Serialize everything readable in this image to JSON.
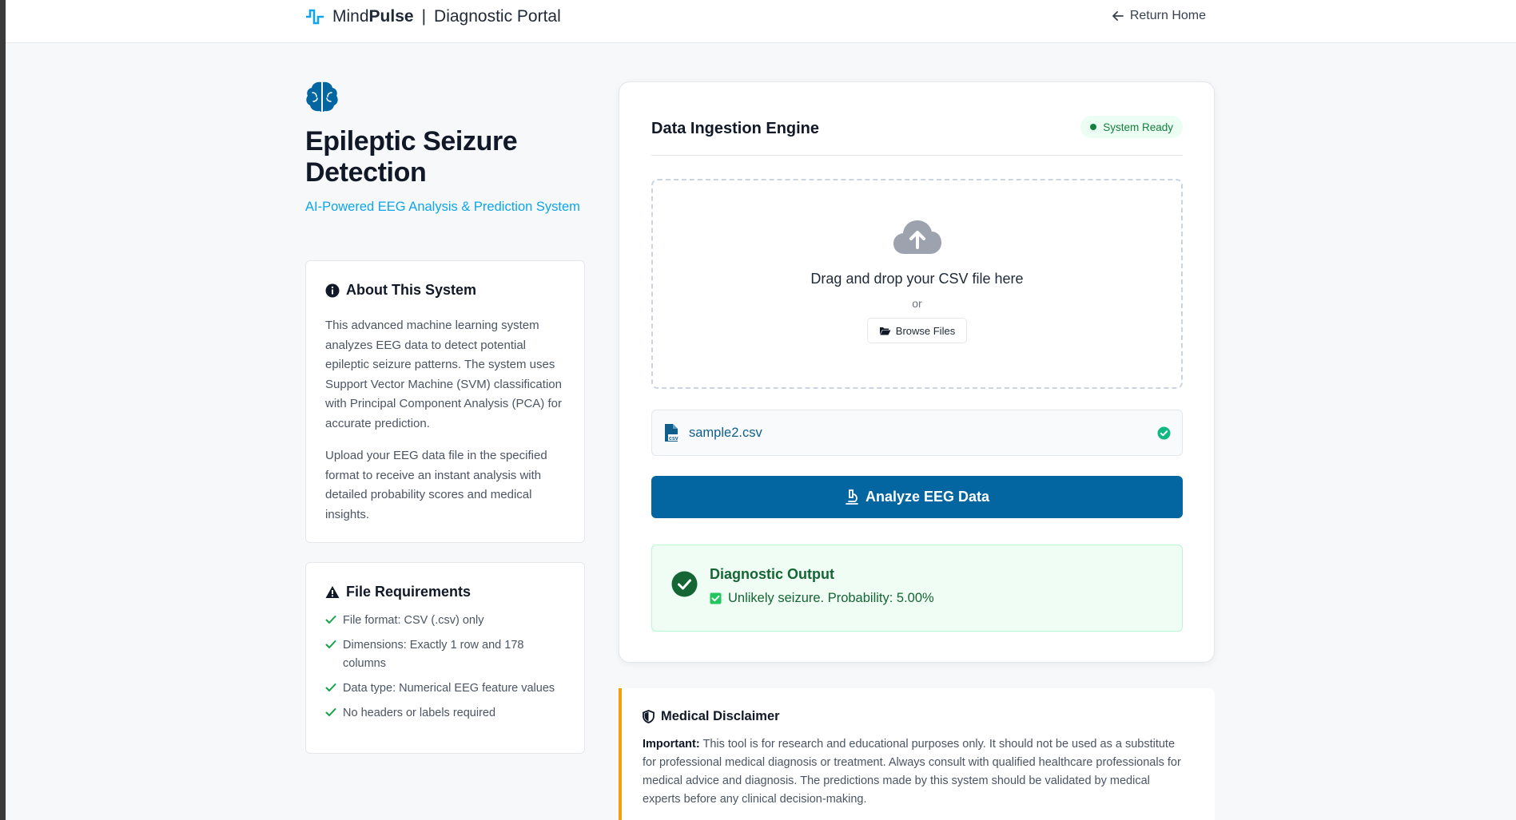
{
  "header": {
    "brand_pre": "Mind",
    "brand_bold": "Pulse",
    "brand_sep": "|",
    "brand_suffix": "Diagnostic Portal",
    "return_label": "Return Home"
  },
  "hero": {
    "title": "Epileptic Seizure Detection",
    "subtitle": "AI-Powered EEG Analysis & Prediction System",
    "icon": "brain-icon"
  },
  "about": {
    "heading": "About This System",
    "paragraph1": "This advanced machine learning system analyzes EEG data to detect potential epileptic seizure patterns. The system uses Support Vector Machine (SVM) classification with Principal Component Analysis (PCA) for accurate prediction.",
    "paragraph2": "Upload your EEG data file in the specified format to receive an instant analysis with detailed probability scores and medical insights."
  },
  "requirements": {
    "heading": "File Requirements",
    "items": [
      "File format: CSV (.csv) only",
      "Dimensions: Exactly 1 row and 178 columns",
      "Data type: Numerical EEG feature values",
      "No headers or labels required"
    ]
  },
  "engine": {
    "title": "Data Ingestion Engine",
    "status": "System Ready",
    "dropzone_text": "Drag and drop your CSV file here",
    "or_text": "or",
    "browse_label": "Browse Files",
    "file_name": "sample2.csv",
    "analyze_label": "Analyze EEG Data",
    "output_title": "Diagnostic Output",
    "output_result": "Unlikely seizure. Probability: 5.00%"
  },
  "disclaimer": {
    "heading": "Medical Disclaimer",
    "lead": "Important:",
    "text": "This tool is for research and educational purposes only. It should not be used as a substitute for professional medical diagnosis or treatment. Always consult with qualified healthcare professionals for medical advice and diagnosis. The predictions made by this system should be validated by medical experts before any clinical decision-making."
  },
  "colors": {
    "primary": "#0466a0",
    "accent": "#0ea5e9",
    "success": "#15803d",
    "warning": "#f59e0b"
  }
}
